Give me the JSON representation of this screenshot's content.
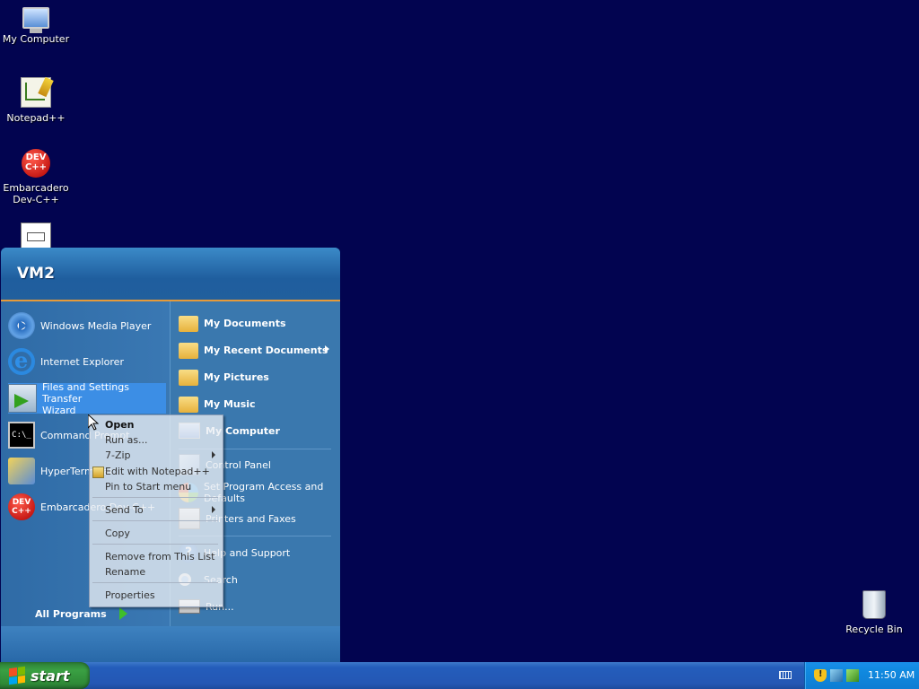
{
  "desktop": {
    "icons": [
      {
        "label": "My Computer"
      },
      {
        "label": "Notepad++"
      },
      {
        "label": "Embarcadero Dev-C++",
        "line1": "Embarcadero",
        "line2": "Dev-C++"
      },
      {
        "label": ""
      },
      {
        "label": "Recycle Bin"
      }
    ]
  },
  "start_menu": {
    "user": "VM2",
    "pinned_programs": [
      {
        "label": "Windows Media Player",
        "icon": "windows-media-player-icon"
      },
      {
        "label": "Internet Explorer",
        "icon": "internet-explorer-icon"
      },
      {
        "label": "Files and Settings Transfer Wizard",
        "line1": "Files and Settings Transfer",
        "line2": "Wizard",
        "icon": "transfer-wizard-icon",
        "selected": true
      },
      {
        "label": "Command Prompt",
        "icon": "command-prompt-icon"
      },
      {
        "label": "HyperTerminal",
        "icon": "hyperterminal-icon"
      },
      {
        "label": "Embarcadero Dev-C++",
        "icon": "devcpp-icon"
      }
    ],
    "all_programs": "All Programs",
    "places": [
      {
        "label": "My Documents",
        "icon": "my-documents-icon",
        "bold": true
      },
      {
        "label": "My Recent Documents",
        "icon": "recent-documents-icon",
        "bold": true,
        "submenu": true
      },
      {
        "label": "My Pictures",
        "icon": "my-pictures-icon",
        "bold": true
      },
      {
        "label": "My Music",
        "icon": "my-music-icon",
        "bold": true
      },
      {
        "label": "My Computer",
        "icon": "my-computer-icon",
        "bold": true
      },
      {
        "label": "Control Panel",
        "icon": "control-panel-icon"
      },
      {
        "label": "Set Program Access and Defaults",
        "line1": "Set Program Access and",
        "line2": "Defaults",
        "icon": "program-access-icon"
      },
      {
        "label": "Printers and Faxes",
        "icon": "printers-icon"
      },
      {
        "label": "Help and Support",
        "icon": "help-icon"
      },
      {
        "label": "Search",
        "icon": "search-icon"
      },
      {
        "label": "Run...",
        "icon": "run-icon"
      }
    ]
  },
  "context_menu": {
    "items": [
      {
        "label": "Open",
        "bold": true
      },
      {
        "label": "Run as..."
      },
      {
        "label": "7-Zip",
        "submenu": true
      },
      {
        "label": "Edit with Notepad++"
      },
      {
        "label": "Pin to Start menu"
      },
      {
        "label": "Send To",
        "submenu": true
      },
      {
        "label": "Copy"
      },
      {
        "label": "Remove from This List"
      },
      {
        "label": "Rename"
      },
      {
        "label": "Properties"
      }
    ]
  },
  "taskbar": {
    "start_label": "start",
    "clock": "11:50 AM"
  },
  "colors": {
    "desktop": "#020450",
    "start_header": "#1f5e9e",
    "taskbar": "#245dbb",
    "start_button": "#3aa043",
    "tray": "#118ae0"
  }
}
